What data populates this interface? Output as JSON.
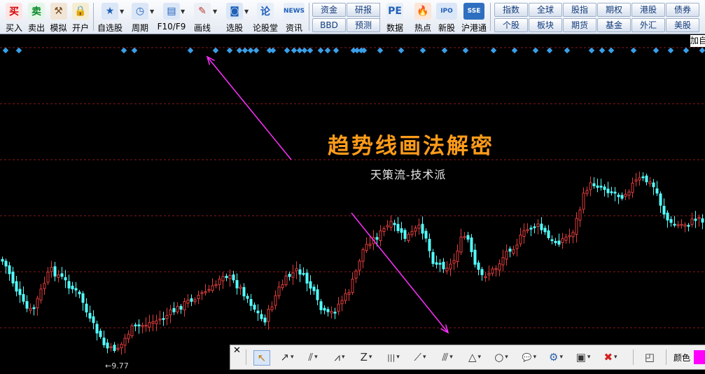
{
  "toolbar": {
    "buttons": [
      {
        "id": "buy",
        "label": "买入",
        "icon": "buy-icon",
        "glyph": "买",
        "color": "#d40000",
        "bg": "#fde6e6"
      },
      {
        "id": "sell",
        "label": "卖出",
        "icon": "sell-icon",
        "glyph": "卖",
        "color": "#0a8a2a",
        "bg": "#e4f6e8"
      },
      {
        "id": "simulate",
        "label": "模拟",
        "icon": "gavel-icon",
        "glyph": "⚒",
        "color": "#7a4a1e",
        "bg": "#f1e6d6"
      },
      {
        "id": "open_account",
        "label": "开户",
        "icon": "lock-icon",
        "glyph": "🔒",
        "color": "#a87a10",
        "bg": "#f6edd0"
      },
      {
        "id": "watchlist",
        "label": "自选股",
        "icon": "star-window-icon",
        "glyph": "★",
        "color": "#1f5fb8",
        "bg": "#dbe7f7"
      },
      {
        "id": "period",
        "label": "周期",
        "icon": "clock-icon",
        "glyph": "◷",
        "color": "#1f5fb8",
        "bg": "#dbe7f7"
      },
      {
        "id": "f10",
        "label": "F10/F9",
        "icon": "document-icon",
        "glyph": "▤",
        "color": "#1f5fb8",
        "bg": "#dbe7f7"
      },
      {
        "id": "draw",
        "label": "画线",
        "icon": "pencil-icon",
        "glyph": "✎",
        "color": "#c0392b",
        "bg": "#ecf0f6"
      },
      {
        "id": "pick",
        "label": "选股",
        "icon": "screener-icon",
        "glyph": "◙",
        "color": "#1f5fb8",
        "bg": "#dbe7f7"
      },
      {
        "id": "forum",
        "label": "论股堂",
        "icon": "forum-icon",
        "glyph": "论",
        "color": "#1f5fb8",
        "bg": "#e9eff8"
      },
      {
        "id": "news",
        "label": "资讯",
        "icon": "news-icon",
        "glyph": "NEWS",
        "color": "#1f5fb8",
        "bg": "#e9eff8"
      },
      {
        "id": "data",
        "label": "数据",
        "icon": "pe-icon",
        "glyph": "PE",
        "color": "#1f5fb8",
        "bg": "#e9eff8"
      },
      {
        "id": "hot",
        "label": "热点",
        "icon": "flame-icon",
        "glyph": "🔥",
        "color": "#d04010",
        "bg": "#fbe6d8"
      },
      {
        "id": "ipo",
        "label": "新股",
        "icon": "ipo-icon",
        "glyph": "IPO",
        "color": "#1f5fb8",
        "bg": "#dbe7f7"
      },
      {
        "id": "hk_connect",
        "label": "沪港通",
        "icon": "sse-hkex-icon",
        "glyph": "SSE",
        "color": "#ffffff",
        "bg": "#2f6fc0"
      }
    ],
    "mini_buttons": [
      {
        "id": "capital",
        "label": "资金"
      },
      {
        "id": "research",
        "label": "研报"
      },
      {
        "id": "bbd",
        "label": "BBD"
      },
      {
        "id": "forecast",
        "label": "预测"
      }
    ],
    "markets": [
      {
        "id": "index",
        "label": "指数"
      },
      {
        "id": "global",
        "label": "全球"
      },
      {
        "id": "stock_index",
        "label": "股指"
      },
      {
        "id": "options",
        "label": "期权"
      },
      {
        "id": "hk_stock",
        "label": "港股"
      },
      {
        "id": "bonds",
        "label": "债券"
      },
      {
        "id": "individual",
        "label": "个股"
      },
      {
        "id": "sector",
        "label": "板块"
      },
      {
        "id": "futures",
        "label": "期货"
      },
      {
        "id": "funds",
        "label": "基金"
      },
      {
        "id": "forex",
        "label": "外汇"
      },
      {
        "id": "us_stock",
        "label": "美股"
      }
    ]
  },
  "chart": {
    "title": "趋势线画法解密",
    "subtitle": "天策流-技术派",
    "low_label": "9.77",
    "corner_label": "加自",
    "up_color": "#e03c3c",
    "down_color": "#54ffff",
    "grid_color": "#8b1a1a",
    "marker_color": "#3a9fe8",
    "arrow_color": "#ff30ff",
    "title_color": "#ff9c1a"
  },
  "drawbar": {
    "color_label": "颜色",
    "current_color": "#ff00ff",
    "tools": [
      {
        "id": "select",
        "icon": "cursor-icon",
        "glyph": "↖"
      },
      {
        "id": "arrow_line",
        "icon": "arrow-line-icon",
        "glyph": "↗"
      },
      {
        "id": "parallel_lines",
        "icon": "parallel-lines-icon",
        "glyph": "⫽"
      },
      {
        "id": "wave",
        "icon": "wave-icon",
        "glyph": "⩘"
      },
      {
        "id": "zigzag",
        "icon": "zigzag-icon",
        "glyph": "Z"
      },
      {
        "id": "vertical_lines",
        "icon": "vertical-lines-icon",
        "glyph": "|||"
      },
      {
        "id": "fan",
        "icon": "fan-icon",
        "glyph": "⟋"
      },
      {
        "id": "channel",
        "icon": "channel-icon",
        "glyph": "⫻"
      },
      {
        "id": "triangle",
        "icon": "triangle-icon",
        "glyph": "△"
      },
      {
        "id": "ellipse",
        "icon": "ellipse-icon",
        "glyph": "○"
      },
      {
        "id": "callout",
        "icon": "callout-icon",
        "glyph": "💬"
      },
      {
        "id": "settings",
        "icon": "gear-icon",
        "glyph": "⚙"
      },
      {
        "id": "erase",
        "icon": "eraser-icon",
        "glyph": "▣"
      },
      {
        "id": "delete",
        "icon": "delete-icon",
        "glyph": "✖"
      },
      {
        "id": "layout",
        "icon": "layout-icon",
        "glyph": "◰"
      }
    ]
  }
}
